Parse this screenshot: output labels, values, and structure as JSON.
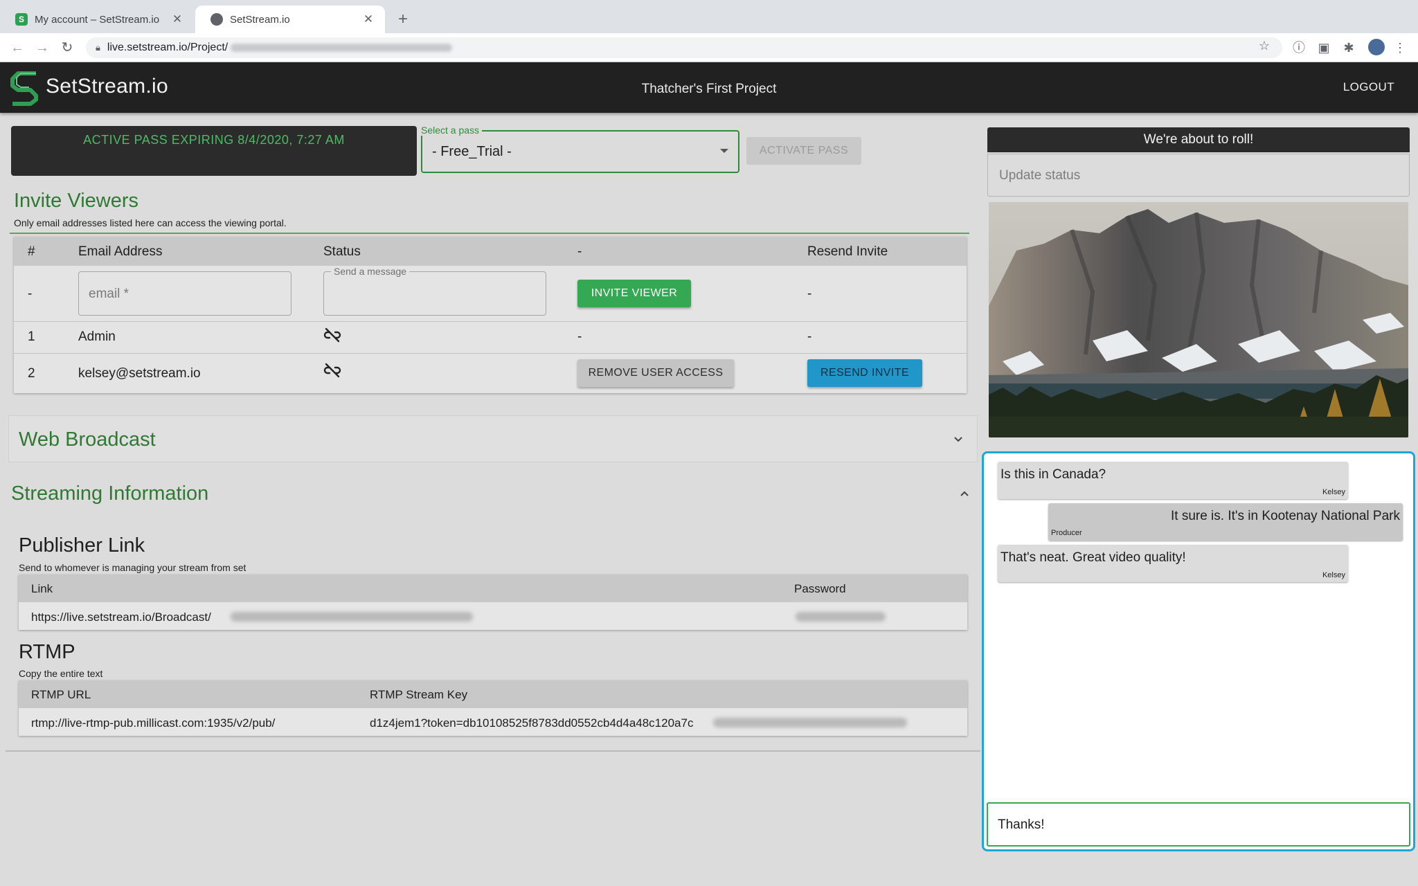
{
  "browser": {
    "tabs": [
      {
        "title": "My account – SetStream.io",
        "active": false
      },
      {
        "title": "SetStream.io",
        "active": true
      }
    ],
    "url": "live.setstream.io/Project/"
  },
  "header": {
    "brand": "SetStream.io",
    "project_title": "Thatcher's First Project",
    "logout_label": "LOGOUT"
  },
  "pass": {
    "active_text": "ACTIVE PASS EXPIRING 8/4/2020, 7:27 AM",
    "select_label": "Select a pass",
    "selected": "- Free_Trial -",
    "activate_label": "ACTIVATE PASS"
  },
  "invite": {
    "title": "Invite Viewers",
    "subtitle": "Only email addresses listed here can access the viewing portal.",
    "columns": [
      "#",
      "Email Address",
      "Status",
      "-",
      "Resend Invite"
    ],
    "new_row": {
      "num": "-",
      "email_placeholder": "email *",
      "message_label": "Send a message",
      "invite_label": "INVITE VIEWER",
      "resend": "-"
    },
    "rows": [
      {
        "num": "1",
        "email": "Admin",
        "action": "-",
        "resend": "-"
      },
      {
        "num": "2",
        "email": "kelsey@setstream.io",
        "action": "REMOVE USER ACCESS",
        "resend": "RESEND INVITE"
      }
    ]
  },
  "web_broadcast": {
    "title": "Web Broadcast"
  },
  "streaming": {
    "title": "Streaming Information",
    "publisher": {
      "title": "Publisher Link",
      "subtitle": "Send to whomever is managing your stream from set",
      "columns": [
        "Link",
        "Password"
      ],
      "link": "https://live.setstream.io/Broadcast/"
    },
    "rtmp": {
      "title": "RTMP",
      "subtitle": "Copy the entire text",
      "columns": [
        "RTMP URL",
        "RTMP Stream Key"
      ],
      "url": "rtmp://live-rtmp-pub.millicast.com:1935/v2/pub/",
      "key": "d1z4jem1?token=db10108525f8783dd0552cb4d4a48c120a7c"
    }
  },
  "side": {
    "status_banner": "We're about to roll!",
    "status_placeholder": "Update status"
  },
  "chat": {
    "messages": [
      {
        "text": "Is this in Canada?",
        "author": "Kelsey"
      },
      {
        "text": "It sure is. It's in Kootenay National Park",
        "author": "Producer"
      },
      {
        "text": "That's neat. Great video quality!",
        "author": "Kelsey"
      }
    ],
    "input_value": "Thanks!"
  },
  "colors": {
    "accent_green": "#2f7a33",
    "button_green": "#35a853",
    "button_blue": "#2196c9",
    "chat_border": "#1fa6d8",
    "pass_text": "#4dbb66"
  }
}
